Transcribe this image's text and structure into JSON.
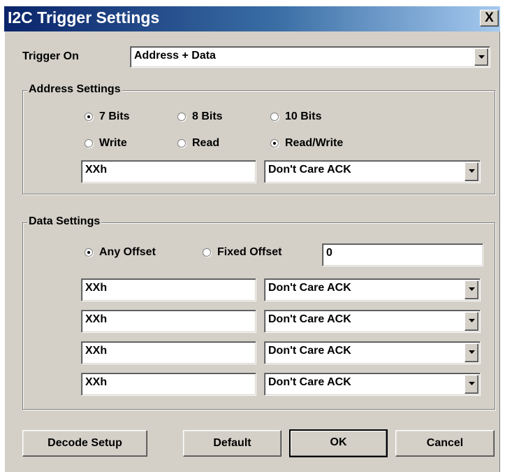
{
  "window": {
    "title": "I2C Trigger Settings",
    "close_label": "X"
  },
  "trigger_on": {
    "label": "Trigger On",
    "value": "Address + Data"
  },
  "address_settings": {
    "title": "Address Settings",
    "bits_options": [
      {
        "label": "7 Bits",
        "selected": true
      },
      {
        "label": "8 Bits",
        "selected": false
      },
      {
        "label": "10 Bits",
        "selected": false
      }
    ],
    "direction_options": [
      {
        "label": "Write",
        "selected": false
      },
      {
        "label": "Read",
        "selected": false
      },
      {
        "label": "Read/Write",
        "selected": true
      }
    ],
    "address_value": "XXh",
    "ack_value": "Don't Care ACK"
  },
  "data_settings": {
    "title": "Data Settings",
    "offset_options": [
      {
        "label": "Any Offset",
        "selected": true
      },
      {
        "label": "Fixed Offset",
        "selected": false
      }
    ],
    "offset_value": "0",
    "rows": [
      {
        "data": "XXh",
        "ack": "Don't Care ACK"
      },
      {
        "data": "XXh",
        "ack": "Don't Care ACK"
      },
      {
        "data": "XXh",
        "ack": "Don't Care ACK"
      },
      {
        "data": "XXh",
        "ack": "Don't Care ACK"
      }
    ]
  },
  "buttons": {
    "decode_setup": "Decode Setup",
    "default": "Default",
    "ok": "OK",
    "cancel": "Cancel"
  },
  "colors": {
    "title_start": "#0a246a",
    "title_end": "#a6caf0",
    "face": "#d4d0c8"
  }
}
